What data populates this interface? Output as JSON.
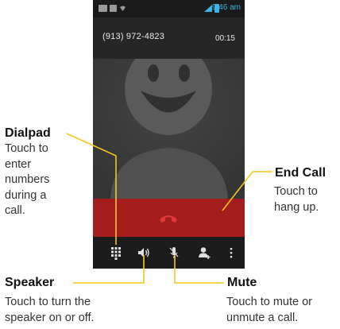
{
  "status_bar": {
    "time": "9:46 am",
    "battery_color": "#3ab3e6"
  },
  "call": {
    "number": "(913) 972-4823",
    "duration": "00:15",
    "end_call_color": "#a31d1d"
  },
  "action_bar": {
    "buttons": [
      {
        "icon": "dialpad-icon"
      },
      {
        "icon": "speaker-icon"
      },
      {
        "icon": "mute-microphone-icon"
      },
      {
        "icon": "add-contact-icon"
      },
      {
        "icon": "more-options-icon"
      }
    ]
  },
  "callouts": {
    "dialpad": {
      "title": "Dialpad",
      "description": "Touch to enter numbers during a call."
    },
    "end_call": {
      "title": "End Call",
      "description": "Touch to hang up."
    },
    "speaker": {
      "title": "Speaker",
      "description": "Touch to turn the speaker on or off."
    },
    "mute": {
      "title": "Mute",
      "description": "Touch to mute or unmute a call."
    }
  },
  "callout_line_color": "#f2c81f"
}
